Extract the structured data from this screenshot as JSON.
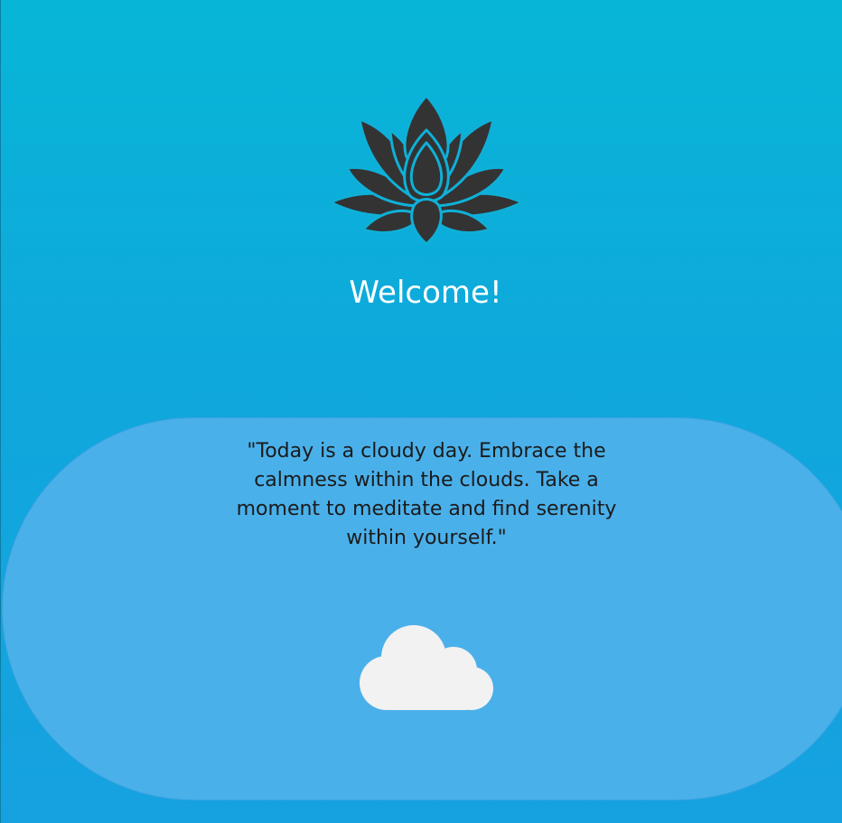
{
  "header": {
    "logo_icon": "lotus-icon",
    "welcome_text": "Welcome!"
  },
  "quote_card": {
    "quote": "\"Today is a cloudy day. Embrace the calmness within the clouds. Take a moment to meditate and find serenity within yourself.\"",
    "weather_icon": "cloud-icon",
    "weather_condition": "cloudy"
  },
  "colors": {
    "background_top": "#07b6d6",
    "background_bottom": "#16a1e0",
    "card": "#4ab0ea",
    "lotus": "#333333",
    "cloud": "#f2f2f2",
    "title_text": "#ffffff",
    "quote_text": "#1b1b1b"
  }
}
